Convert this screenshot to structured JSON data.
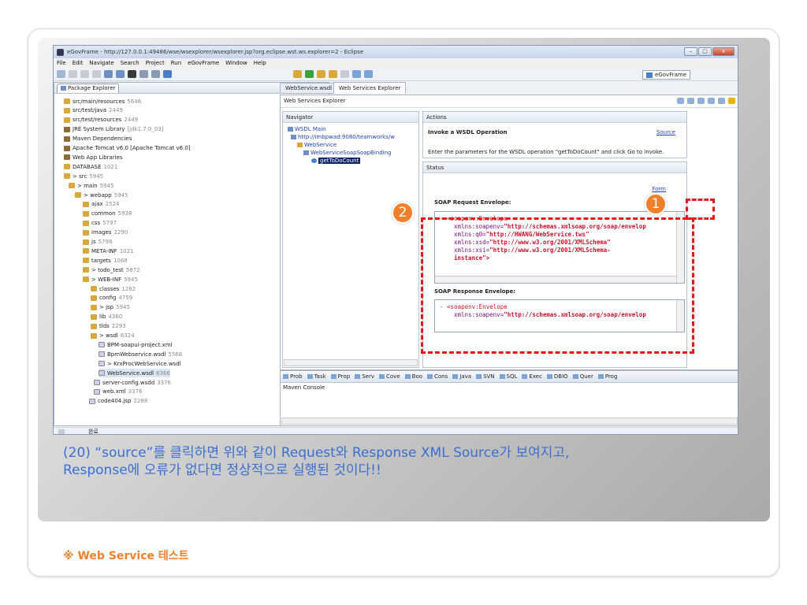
{
  "window": {
    "title": "eGovFrame - http://127.0.0.1:49486/wse/wsexplorer/wsexplorer.jsp?org.eclipse.wst.ws.explorer=2 - Eclipse",
    "controls": [
      "–",
      "▢",
      "x"
    ]
  },
  "menu": [
    "File",
    "Edit",
    "Navigate",
    "Search",
    "Project",
    "Run",
    "eGovFrame",
    "Window",
    "Help"
  ],
  "perspective": "eGovFrame",
  "package_explorer": {
    "tab": "Package Explorer",
    "items": [
      {
        "label": "src/main/resources",
        "num": "5646",
        "icon": "folder-icon"
      },
      {
        "label": "src/test/java",
        "num": "2449",
        "icon": "folder-icon"
      },
      {
        "label": "src/test/resources",
        "num": "2449",
        "icon": "folder-icon"
      },
      {
        "label": "JRE System Library",
        "num": "[jdk1.7.0_03]",
        "icon": "library-icon"
      },
      {
        "label": "Maven Dependencies",
        "num": "",
        "icon": "library-icon"
      },
      {
        "label": "Apache Tomcat v6.0 [Apache Tomcat v6.0]",
        "num": "",
        "icon": "library-icon"
      },
      {
        "label": "Web App Libraries",
        "num": "",
        "icon": "library-icon"
      },
      {
        "label": "DATABASE",
        "num": "1021",
        "icon": "folder-icon"
      },
      {
        "label": "> src",
        "num": "5945",
        "icon": "folder-icon"
      },
      {
        "label": "> main",
        "num": "5945",
        "icon": "folder-icon"
      },
      {
        "label": "> webapp",
        "num": "5945",
        "icon": "folder-icon"
      },
      {
        "label": "ajax",
        "num": "2524",
        "icon": "folder-icon"
      },
      {
        "label": "common",
        "num": "5938",
        "icon": "folder-icon"
      },
      {
        "label": "css",
        "num": "5797",
        "icon": "folder-icon"
      },
      {
        "label": "images",
        "num": "2290",
        "icon": "folder-icon"
      },
      {
        "label": "js",
        "num": "5798",
        "icon": "folder-icon"
      },
      {
        "label": "META-INF",
        "num": "1021",
        "icon": "folder-icon"
      },
      {
        "label": "targets",
        "num": "1068",
        "icon": "folder-icon"
      },
      {
        "label": "> todo_test",
        "num": "5872",
        "icon": "folder-icon"
      },
      {
        "label": "> WEB-INF",
        "num": "5945",
        "icon": "folder-icon"
      },
      {
        "label": "classes",
        "num": "1282",
        "icon": "folder-icon"
      },
      {
        "label": "config",
        "num": "4759",
        "icon": "folder-icon"
      },
      {
        "label": "> jsp",
        "num": "5945",
        "icon": "folder-icon"
      },
      {
        "label": "lib",
        "num": "4360",
        "icon": "folder-icon"
      },
      {
        "label": "tlds",
        "num": "2293",
        "icon": "folder-icon"
      },
      {
        "label": "> wsdl",
        "num": "6324",
        "icon": "folder-icon"
      },
      {
        "label": "BPM-soapui-project.xml",
        "num": "",
        "icon": "file-icon"
      },
      {
        "label": "BpmWebservice.wsdl",
        "num": "5568",
        "icon": "file-icon"
      },
      {
        "label": "> KrxProcWebService.wsdl",
        "num": "",
        "icon": "file-icon"
      },
      {
        "label": "WebService.wsdl",
        "num": "6366",
        "icon": "file-icon"
      },
      {
        "label": "server-config.wsdd",
        "num": "3376",
        "icon": "file-icon"
      },
      {
        "label": "web.xml",
        "num": "3376",
        "icon": "file-icon"
      },
      {
        "label": "code404.jsp",
        "num": "2288",
        "icon": "file-icon"
      }
    ]
  },
  "editor_tabs": [
    "WebService.wsdl",
    "Web Services Explorer"
  ],
  "wse": {
    "title": "Web Services Explorer",
    "navigator": "Navigator",
    "nav_items": [
      "WSDL Main",
      "http://imbpwad:9080/teamworks/w",
      "WebService",
      "WebServiceSoapSoapBinding",
      "getToDoCount"
    ],
    "actions": "Actions",
    "invoke": "Invoke a WSDL Operation",
    "source_link": "Source",
    "enter_params": "Enter the parameters for the WSDL operation \"getToDoCount\" and click Go to invoke.",
    "status": "Status",
    "form_link": "Form",
    "request_head": "SOAP Request Envelope:",
    "response_head": "SOAP Response Envelope:",
    "req_lines": [
      {
        "tag": "- <soapenv:Envelope",
        "attr": "",
        "val": ""
      },
      {
        "tag": "",
        "attr": "xmlns:soapenv=",
        "val": "\"http://schemas.xmlsoap.org/soap/envelop"
      },
      {
        "tag": "",
        "attr": "xmlns:q0=",
        "val": "\"http://HWANG/WebService.tws\""
      },
      {
        "tag": "",
        "attr": "xmlns:xsd=",
        "val": "\"http://www.w3.org/2001/XMLSchema\""
      },
      {
        "tag": "",
        "attr": "xmlns:xsi=",
        "val": "\"http://www.w3.org/2001/XMLSchema-"
      },
      {
        "tag": "",
        "attr": "",
        "val": "instance\">"
      }
    ],
    "resp_lines": [
      {
        "tag": "- <soapenv:Envelope",
        "attr": "",
        "val": ""
      },
      {
        "tag": "",
        "attr": "xmlns:soapenv=",
        "val": "\"http://schemas.xmlsoap.org/soap/envelop"
      }
    ]
  },
  "console": {
    "tabs": [
      "Prob",
      "Task",
      "Prop",
      "Serv",
      "Cove",
      "Boo",
      "Cons",
      "Java",
      "SVN",
      "SQL",
      "Exec",
      "DBIO",
      "Quer",
      "Prog"
    ],
    "title": "Maven Console"
  },
  "status_bar": "완료",
  "callouts": [
    "1",
    "2"
  ],
  "caption_line1": "(20) “source”를 클릭하면 위와 같이 Request와 Response XML Source가 보여지고,",
  "caption_line2": "Response에 오류가 없다면 정상적으로 실행된 것이다!!",
  "footer": "※ Web Service 테스트",
  "colors": {
    "accent": "#f0812a",
    "highlight": "#e01919",
    "caption": "#3b6fd0"
  }
}
